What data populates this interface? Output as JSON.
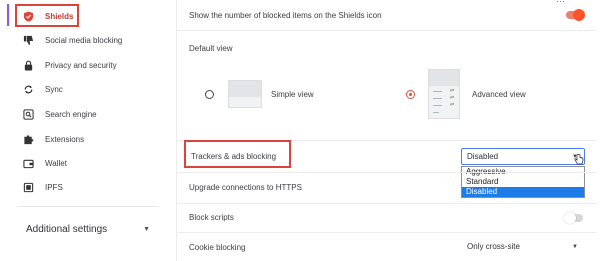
{
  "sidebar": {
    "items": [
      {
        "label": "Shields",
        "icon": "shield-icon",
        "active": true
      },
      {
        "label": "Social media blocking",
        "icon": "thumbs-down-icon"
      },
      {
        "label": "Privacy and security",
        "icon": "lock-icon"
      },
      {
        "label": "Sync",
        "icon": "sync-icon"
      },
      {
        "label": "Search engine",
        "icon": "search-icon"
      },
      {
        "label": "Extensions",
        "icon": "puzzle-icon"
      },
      {
        "label": "Wallet",
        "icon": "wallet-icon"
      },
      {
        "label": "IPFS",
        "icon": "ipfs-icon"
      }
    ],
    "additional_settings": "Additional settings"
  },
  "main": {
    "show_count_label": "Show the number of blocked items on the Shields icon",
    "show_count_on": true,
    "default_view_label": "Default view",
    "simple_view_label": "Simple view",
    "advanced_view_label": "Advanced view",
    "selected_view": "Advanced view",
    "trackers_label": "Trackers & ads blocking",
    "trackers_value": "Disabled",
    "trackers_options": [
      "Aggressive",
      "Standard",
      "Disabled"
    ],
    "upgrade_https_label": "Upgrade connections to HTTPS",
    "block_scripts_label": "Block scripts",
    "block_scripts_on": false,
    "cookie_label": "Cookie blocking",
    "cookie_value": "Only cross-site"
  },
  "colors": {
    "accent": "#fb542b",
    "highlight": "#d9453a",
    "active_nav": "#c23a2f",
    "dropdown_selected": "#1e7ce8"
  }
}
